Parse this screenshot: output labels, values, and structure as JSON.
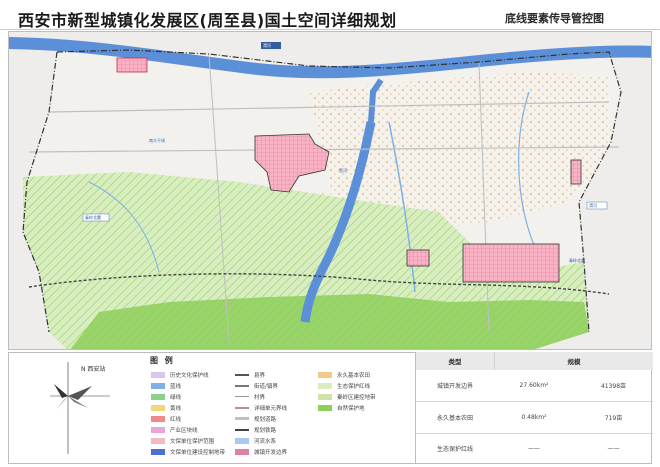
{
  "header": {
    "title": "西安市新型城镇化发展区(周至县)国土空间详细规划",
    "subtitle": "底线要素传导管控图"
  },
  "map": {
    "labels": [
      {
        "text": "渭河"
      },
      {
        "text": "渭河"
      },
      {
        "text": "黑河"
      },
      {
        "text": "秦岭北麓"
      },
      {
        "text": "秦岭北麓"
      },
      {
        "text": "南大干线"
      }
    ],
    "colors": {
      "river": "#5b8fd8",
      "farmland": "#f3c98a",
      "ecological": "#cfe9a8",
      "nature": "#8dcf5a",
      "urban": "#f2a6b8",
      "boundary": "#333333"
    }
  },
  "compass": {
    "label": "N 西安站"
  },
  "legend": {
    "title": "图 例",
    "col1": [
      {
        "label": "历史文化保护线",
        "color": "#d7c6f0"
      },
      {
        "label": "蓝线",
        "color": "#7fb0e6"
      },
      {
        "label": "绿线",
        "color": "#8fd08f"
      },
      {
        "label": "黄线",
        "color": "#f2d77a"
      },
      {
        "label": "红线",
        "color": "#f08a8a"
      },
      {
        "label": "产业区块线",
        "color": "#e9a6d6"
      },
      {
        "label": "文保单位保护范围",
        "color": "#f5b8c4"
      },
      {
        "label": "文保单位建设控制地带",
        "color": "#4f6fd6"
      }
    ],
    "col2": [
      {
        "label": "县界",
        "color": "#555555"
      },
      {
        "label": "街道/镇界",
        "color": "#777777"
      },
      {
        "label": "村界",
        "color": "#999999"
      },
      {
        "label": "详细单元界线",
        "color": "#bb88aa"
      },
      {
        "label": "规划道路",
        "color": "#bfbfbf"
      },
      {
        "label": "规划铁路",
        "color": "#444444"
      },
      {
        "label": "河流水系",
        "color": "#a8c8f0"
      },
      {
        "label": "城镇开发边界",
        "color": "#e07fa8"
      }
    ],
    "col3": [
      {
        "label": "永久基本农田",
        "color": "#f3c98a"
      },
      {
        "label": "生态保护红线",
        "color": "#d8eec0"
      },
      {
        "label": "秦岭区建控地带",
        "color": "#cfe2a8"
      },
      {
        "label": "自然保护地",
        "color": "#8dcf5a"
      }
    ]
  },
  "table": {
    "headers": [
      "类型",
      "规模"
    ],
    "rows": [
      {
        "type": "城镇开发边界",
        "v1": "27.60km²",
        "v2": "41398亩"
      },
      {
        "type": "永久基本农田",
        "v1": "0.48km²",
        "v2": "719亩"
      },
      {
        "type": "生态保护红线",
        "v1": "——",
        "v2": "——"
      }
    ]
  }
}
